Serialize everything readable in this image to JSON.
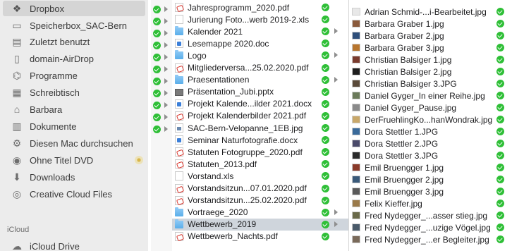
{
  "sidebar": {
    "items": [
      {
        "label": "Dropbox",
        "icon": "dropbox-icon",
        "selected": true
      },
      {
        "label": "Speicherbox_SAC-Bern",
        "icon": "folder-icon"
      },
      {
        "label": "Zuletzt benutzt",
        "icon": "recents-icon"
      },
      {
        "label": "domain-AirDrop",
        "icon": "document-icon"
      },
      {
        "label": "Programme",
        "icon": "applications-icon"
      },
      {
        "label": "Schreibtisch",
        "icon": "desktop-icon"
      },
      {
        "label": "Barbara",
        "icon": "home-icon"
      },
      {
        "label": "Dokumente",
        "icon": "documents-icon"
      },
      {
        "label": "Diesen Mac durchsuchen",
        "icon": "gear-icon"
      },
      {
        "label": "Ohne Titel DVD",
        "icon": "dvd-icon",
        "eject": true
      },
      {
        "label": "Downloads",
        "icon": "downloads-icon"
      },
      {
        "label": "Creative Cloud Files",
        "icon": "creative-cloud-icon"
      }
    ],
    "section_icloud": "iCloud",
    "icloud_drive": "iCloud Drive"
  },
  "column1": {
    "sync_rows": [
      true,
      true,
      true,
      true,
      true,
      true,
      true,
      true,
      true,
      true,
      true
    ]
  },
  "column2": {
    "items": [
      {
        "name": "Jahresprogramm_2020.pdf",
        "type": "pdf"
      },
      {
        "name": "Jurierung Foto...werb 2019-2.xls",
        "type": "xls"
      },
      {
        "name": "Kalender 2021",
        "type": "folder",
        "arrow": true
      },
      {
        "name": "Lesemappe 2020.doc",
        "type": "doc"
      },
      {
        "name": "Logo",
        "type": "folder",
        "arrow": true
      },
      {
        "name": "Mitgliederversa...25.02.2020.pdf",
        "type": "pdf"
      },
      {
        "name": "Praesentationen",
        "type": "folder",
        "arrow": true
      },
      {
        "name": "Präsentation_Jubi.pptx",
        "type": "pptx"
      },
      {
        "name": "Projekt Kalende...ilder 2021.docx",
        "type": "doc"
      },
      {
        "name": "Projekt Kalenderbilder 2021.pdf",
        "type": "pdf"
      },
      {
        "name": "SAC-Bern-Velopanne_1EB.jpg",
        "type": "jpgdoc"
      },
      {
        "name": "Seminar Naturfotografie.docx",
        "type": "doc"
      },
      {
        "name": "Statuten Fotogruppe_2020.pdf",
        "type": "pdf"
      },
      {
        "name": "Statuten_2013.pdf",
        "type": "pdf"
      },
      {
        "name": "Vorstand.xls",
        "type": "xls"
      },
      {
        "name": "Vorstandsitzun...07.01.2020.pdf",
        "type": "pdf"
      },
      {
        "name": "Vorstandsitzun...25.02.2020.pdf",
        "type": "pdf"
      },
      {
        "name": "Vortraege_2020",
        "type": "folder",
        "arrow": true
      },
      {
        "name": "Wettbewerb_2019",
        "type": "folder",
        "arrow": true,
        "selected": true
      },
      {
        "name": "Wettbewerb_Nachts.pdf",
        "type": "pdf"
      }
    ]
  },
  "column3": {
    "items": [
      {
        "name": "Adrian Schmid-...i-Bearbeitet.jpg",
        "color": "#e8e8e8"
      },
      {
        "name": "Barbara Graber 1.jpg",
        "color": "#8a5a3c"
      },
      {
        "name": "Barbara Graber 2.jpg",
        "color": "#2f4f7a"
      },
      {
        "name": "Barbara Graber 3.jpg",
        "color": "#b8762e"
      },
      {
        "name": "Christian Balsiger 1.jpg",
        "color": "#7a3b2e"
      },
      {
        "name": "Christian Balsiger 2.jpg",
        "color": "#1e1e1e"
      },
      {
        "name": "Christian Balsiger 3.JPG",
        "color": "#5a4a3a"
      },
      {
        "name": "Daniel Gyger_In einer Reihe.jpg",
        "color": "#6b7a5a"
      },
      {
        "name": "Daniel Gyger_Pause.jpg",
        "color": "#8a8a8a"
      },
      {
        "name": "DerFruehlingKo...hanWondrak.jpg",
        "color": "#c9a86a"
      },
      {
        "name": "Dora Stettler 1.JPG",
        "color": "#3a6a9a"
      },
      {
        "name": "Dora Stettler 2.JPG",
        "color": "#4a4a6a"
      },
      {
        "name": "Dora Stettler 3.JPG",
        "color": "#2a2a2a"
      },
      {
        "name": "Emil Bruengger 1.jpg",
        "color": "#8a3a2a"
      },
      {
        "name": "Emil Bruengger 2.jpg",
        "color": "#3a5a7a"
      },
      {
        "name": "Emil Bruengger 3.jpg",
        "color": "#5a5a5a"
      },
      {
        "name": "Felix Kieffer.jpg",
        "color": "#9a7a4a"
      },
      {
        "name": "Fred Nydegger_...asser stieg.jpg",
        "color": "#6a6a4a"
      },
      {
        "name": "Fred Nydegger_...uzige Vögel.jpg",
        "color": "#4a5a6a"
      },
      {
        "name": "Fred Nydegger_...er Begleiter.jpg",
        "color": "#7a6a5a"
      }
    ]
  }
}
